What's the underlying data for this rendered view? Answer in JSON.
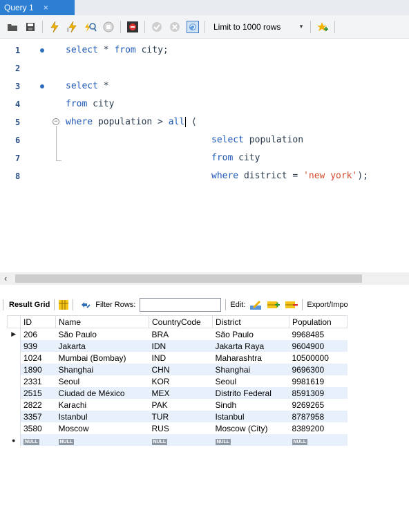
{
  "tab": {
    "title": "Query 1",
    "close": "×"
  },
  "toolbar": {
    "limit_label": "Limit to 1000 rows",
    "dropdown": "▾",
    "icons": [
      "folder-icon",
      "save-icon",
      "execute-icon",
      "execute-current-icon",
      "explain-icon",
      "stop-icon",
      "toggle-error-icon",
      "commit-icon",
      "rollback-icon",
      "autocommit-icon",
      "add-snippet-icon"
    ]
  },
  "editor": {
    "lines": [
      {
        "n": "1"
      },
      {
        "n": "2"
      },
      {
        "n": "3"
      },
      {
        "n": "4"
      },
      {
        "n": "5"
      },
      {
        "n": "6"
      },
      {
        "n": "7"
      },
      {
        "n": "8"
      }
    ],
    "tokens": {
      "l1_kw1": "select",
      "l1_rest": " * ",
      "l1_kw2": "from",
      "l1_id": " city;",
      "l3_kw": "select",
      "l3_rest": " *",
      "l4_kw": "from",
      "l4_id": " city",
      "l5_kw1": "where",
      "l5_id": " population > ",
      "l5_kw2": "all",
      "l5_rest": " (",
      "l6_kw": "select",
      "l6_id": " population",
      "l7_kw": "from",
      "l7_id": " city",
      "l8_kw": "where",
      "l8_id": " district = ",
      "l8_str": "'new york'",
      "l8_rest": ");"
    }
  },
  "results": {
    "result_grid_label": "Result Grid",
    "filter_label": "Filter Rows:",
    "filter_value": "",
    "edit_label": "Edit:",
    "export_label": "Export/Impo",
    "columns": [
      "ID",
      "Name",
      "CountryCode",
      "District",
      "Population"
    ],
    "rows": [
      [
        "206",
        "São Paulo",
        "BRA",
        "São Paulo",
        "9968485"
      ],
      [
        "939",
        "Jakarta",
        "IDN",
        "Jakarta Raya",
        "9604900"
      ],
      [
        "1024",
        "Mumbai (Bombay)",
        "IND",
        "Maharashtra",
        "10500000"
      ],
      [
        "1890",
        "Shanghai",
        "CHN",
        "Shanghai",
        "9696300"
      ],
      [
        "2331",
        "Seoul",
        "KOR",
        "Seoul",
        "9981619"
      ],
      [
        "2515",
        "Ciudad de México",
        "MEX",
        "Distrito Federal",
        "8591309"
      ],
      [
        "2822",
        "Karachi",
        "PAK",
        "Sindh",
        "9269265"
      ],
      [
        "3357",
        "Istanbul",
        "TUR",
        "Istanbul",
        "8787958"
      ],
      [
        "3580",
        "Moscow",
        "RUS",
        "Moscow (City)",
        "8389200"
      ]
    ],
    "null_label": "NULL",
    "current_row_marker": "▶",
    "new_row_marker": "●"
  },
  "colors": {
    "tab": "#2d7fd4",
    "keyword": "#1e57b5",
    "string": "#d14a2c",
    "row_alt": "#e8f0fb"
  }
}
